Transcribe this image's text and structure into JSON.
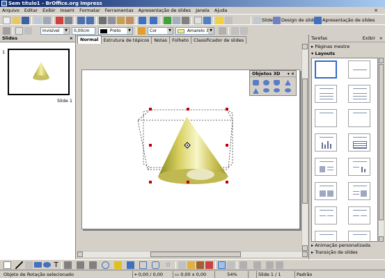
{
  "window": {
    "title": "Sem título1 - BrOffice.org Impress"
  },
  "menu": [
    "Arquivo",
    "Editar",
    "Exibir",
    "Inserir",
    "Formatar",
    "Ferramentas",
    "Apresentação de slides",
    "Janela",
    "Ajuda"
  ],
  "menu_close": "×",
  "toolbar1": {
    "slide_label": "Slide",
    "design_label": "Design de slides",
    "presentation_label": "Apresentação de slides"
  },
  "toolbar2": {
    "line_style": "Invisível",
    "line_width": "0,00cm",
    "line_color": "Preto",
    "fill_type": "Cor",
    "fill_color": "Amarelo 3"
  },
  "slides_pane": {
    "title": "Slides",
    "close": "×",
    "slide_number": "1",
    "slide_label": "Slide 1"
  },
  "tabs": [
    "Normal",
    "Estrutura de tópicos",
    "Notas",
    "Folheto",
    "Classificador de slides"
  ],
  "objetos3d": {
    "title": "Objetos 3D"
  },
  "tasks_pane": {
    "title": "Tarefas",
    "view_label": "Exibir",
    "close": "×",
    "section_master": "Páginas mestre",
    "section_layouts": "Layouts",
    "section_animation": "Animação personalizada",
    "section_transition": "Transição de slides"
  },
  "status": {
    "message": "Objeto de Rotação selecionado",
    "position": "0,00 / 0,00",
    "size": "0,00 x 0,00",
    "zoom": "54%",
    "slide": "Slide 1 / 1",
    "style": "Padrão"
  },
  "colors": {
    "title_bar": "#0a246a",
    "cone_yellow": "#e8e070",
    "handle_red": "#c00000",
    "selected_layout": "#316ac5"
  }
}
